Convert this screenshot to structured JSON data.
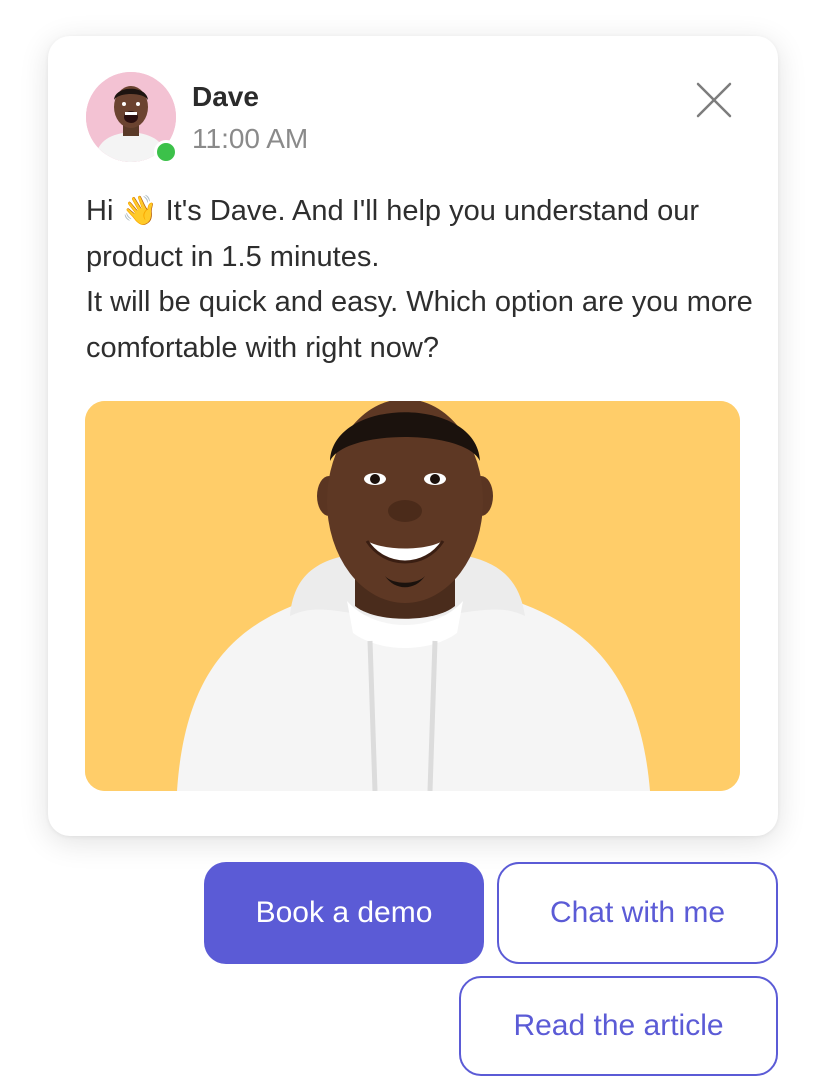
{
  "sender": {
    "name": "Dave",
    "time": "11:00 AM",
    "status": "online",
    "avatar_icon": "avatar-photo",
    "status_color": "#3cc14a"
  },
  "message": {
    "line1_before": "Hi ",
    "emoji": "👋",
    "line1_after": " It's Dave. And I'll help you understand our product in 1.5 minutes.",
    "line2": "It will be quick and easy. Which option are you more comfortable with right now?"
  },
  "photo": {
    "background_color": "#ffcd69"
  },
  "actions": {
    "book_demo": "Book a demo",
    "chat": "Chat with me",
    "article": "Read the article"
  },
  "colors": {
    "accent": "#5b5bd6",
    "avatar_bg": "#f3c2d3"
  },
  "icons": {
    "close": "close-icon",
    "wave": "waving-hand-emoji"
  }
}
